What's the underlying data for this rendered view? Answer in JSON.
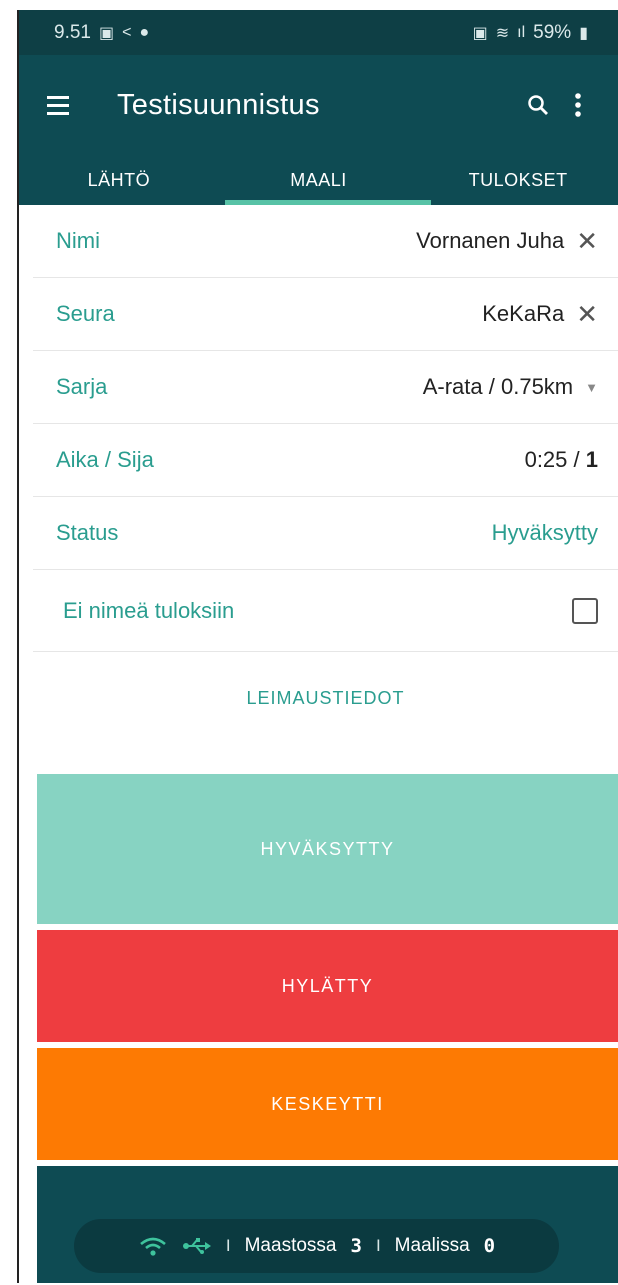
{
  "status_bar": {
    "time": "9.51",
    "battery": "59%"
  },
  "app_bar": {
    "title": "Testisuunnistus"
  },
  "tabs": [
    {
      "label": "LÄHTÖ"
    },
    {
      "label": "MAALI",
      "active": true
    },
    {
      "label": "TULOKSET"
    }
  ],
  "form": {
    "name_label": "Nimi",
    "name_value": "Vornanen Juha",
    "club_label": "Seura",
    "club_value": "KeKaRa",
    "series_label": "Sarja",
    "series_value": "A-rata / 0.75km",
    "time_label": "Aika / Sija",
    "time_value": "0:25",
    "time_sep": " / ",
    "rank_value": "1",
    "status_label": "Status",
    "status_value": "Hyväksytty",
    "hide_name_label": "Ei nimeä tuloksiin",
    "hide_name_checked": false
  },
  "punch_details_link": "LEIMAUSTIEDOT",
  "actions": {
    "approved": "HYVÄKSYTTY",
    "disqualified": "HYLÄTTY",
    "dnf": "KESKEYTTI"
  },
  "footer": {
    "in_forest_label": "Maastossa",
    "in_forest_count": "3",
    "finished_label": "Maalissa",
    "finished_count": "0",
    "separator": "I"
  },
  "colors": {
    "primary": "#0e4b53",
    "accent": "#2a9d8f",
    "approved": "#87d3c2",
    "disqualified": "#ee3d40",
    "dnf": "#fd7a03"
  }
}
